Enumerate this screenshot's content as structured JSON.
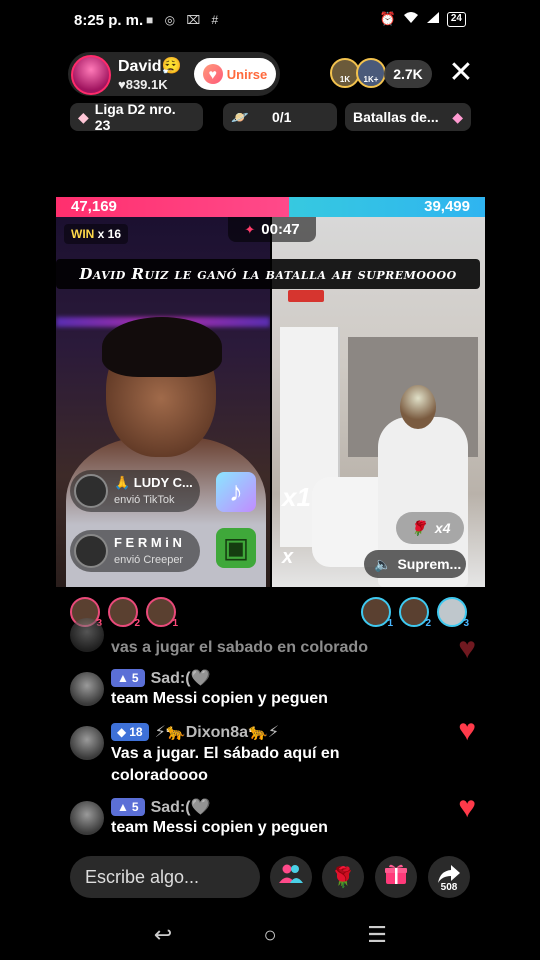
{
  "status_bar": {
    "time": "8:25 p. m.",
    "notification_icons": "■ ◎ ⌧ #",
    "battery": "24"
  },
  "host": {
    "name": "David😮‍💨",
    "likes": "♥839.1K",
    "join_label": "Unirse"
  },
  "viewers": {
    "avatar_badges": [
      "1K",
      "1K+"
    ],
    "count": "2.7K"
  },
  "chips": {
    "league": "Liga D2 nro. 23",
    "goal": "0/1",
    "battles": "Batallas de..."
  },
  "battle": {
    "score_left": 47169,
    "score_left_label": "47,169",
    "score_right": 39499,
    "score_right_label": "39,499",
    "win_label": "WIN",
    "win_count": "x 16",
    "timer": "00:47",
    "banner": "David Ruiz le ganó la batalla ah supremoooo",
    "multiplier_1": "x1",
    "multiplier_2": "x",
    "rose_count": "x4",
    "sound_label": "Suprem..."
  },
  "gift_notices": [
    {
      "name": "🙏 LUDY C...",
      "sub": "envió TikTok"
    },
    {
      "name": "F E R M i N",
      "sub": "envió Creeper"
    }
  ],
  "ranking": {
    "left": [
      "3",
      "2",
      "1"
    ],
    "right": [
      "1",
      "2",
      "3"
    ]
  },
  "chat": [
    {
      "meta": "",
      "level": "",
      "text": "vas a jugar el sabado en colorado"
    },
    {
      "level": "5",
      "username": "Sad:(🩶",
      "text": "team Messi copien y peguen"
    },
    {
      "level": "18",
      "username": "⚡🐆Dixon8a🐆⚡",
      "text": "Vas a jugar.  El sábado aquí en",
      "text2": "coloradoooo"
    },
    {
      "level": "5",
      "username": "Sad:(🩶",
      "text": "team Messi copien y peguen"
    }
  ],
  "input": {
    "placeholder": "Escribe algo..."
  },
  "share_count": "508",
  "colors": {
    "left_team": "#ff2f6e",
    "right_team": "#2fb4f0",
    "heart": "#ff3a4a",
    "join_text": "#ff6a3d"
  },
  "icons": {
    "close": "close-icon",
    "guests": "guests-icon",
    "rose": "rose-icon",
    "gift": "gift-icon",
    "share": "share-icon"
  }
}
